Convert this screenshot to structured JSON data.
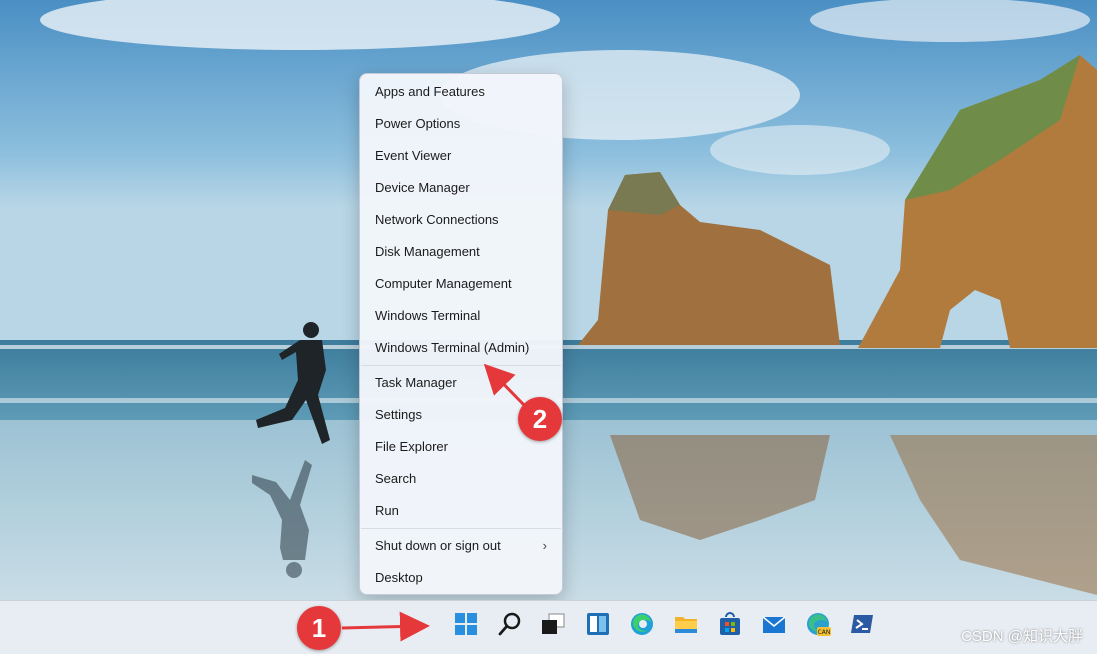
{
  "menu": {
    "items": [
      {
        "label": "Apps and Features"
      },
      {
        "label": "Power Options"
      },
      {
        "label": "Event Viewer"
      },
      {
        "label": "Device Manager"
      },
      {
        "label": "Network Connections"
      },
      {
        "label": "Disk Management"
      },
      {
        "label": "Computer Management"
      },
      {
        "label": "Windows Terminal"
      },
      {
        "label": "Windows Terminal (Admin)"
      },
      {
        "label": "Task Manager"
      },
      {
        "label": "Settings"
      },
      {
        "label": "File Explorer"
      },
      {
        "label": "Search"
      },
      {
        "label": "Run"
      },
      {
        "label": "Shut down or sign out"
      },
      {
        "label": "Desktop"
      }
    ],
    "submenu_chevron": "›"
  },
  "annotations": {
    "badge1": "1",
    "badge2": "2",
    "color": "#e5383b"
  },
  "taskbar": {
    "icons": [
      "windows-start-icon",
      "search-icon",
      "task-view-icon",
      "widgets-icon",
      "edge-icon",
      "file-explorer-icon",
      "microsoft-store-icon",
      "mail-icon",
      "edge-canary-icon",
      "powershell-icon"
    ]
  },
  "watermark": "CSDN @知识大胖"
}
